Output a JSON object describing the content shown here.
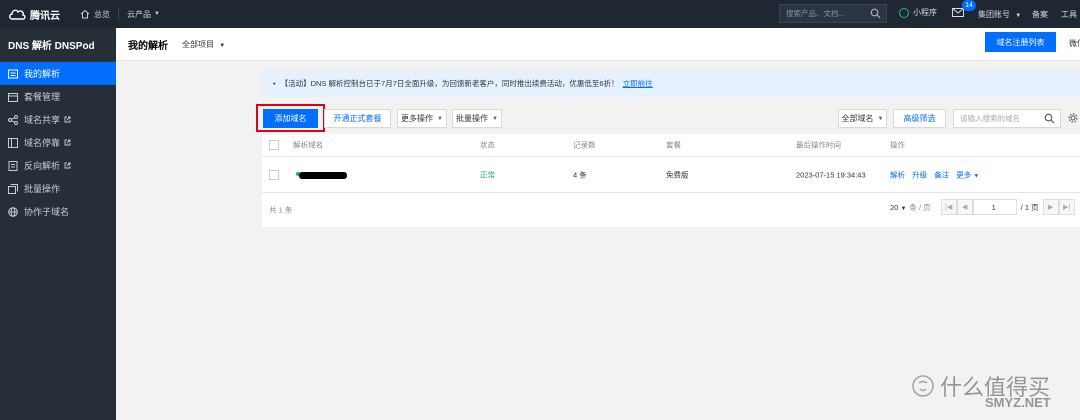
{
  "topbar": {
    "brand": "腾讯云",
    "overview": "总览",
    "products": "云产品",
    "search_placeholder": "搜索产品、文档...",
    "mini_program": "小程序",
    "mail_badge": "14",
    "account": "集团账号",
    "beian": "备案",
    "tools": "工具"
  },
  "sidebar": {
    "title": "DNS 解析 DNSPod",
    "items": [
      {
        "label": "我的解析",
        "icon": "list-icon",
        "active": true
      },
      {
        "label": "套餐管理",
        "icon": "calendar-icon"
      },
      {
        "label": "域名共享",
        "icon": "share-icon",
        "external": true
      },
      {
        "label": "域名停靠",
        "icon": "dock-icon",
        "external": true
      },
      {
        "label": "反向解析",
        "icon": "doc-icon",
        "external": true
      },
      {
        "label": "批量操作",
        "icon": "batch-icon"
      },
      {
        "label": "协作子域名",
        "icon": "globe-icon"
      }
    ]
  },
  "header": {
    "title": "我的解析",
    "project": "全部项目",
    "register_list": "域名注册列表",
    "wechat": "微信"
  },
  "notice": {
    "text": "【活动】DNS 解析控制台已于7月7日全面升级，为回馈新老客户，同时推出续费活动，优惠低至6折！",
    "link": "立即前往"
  },
  "toolbar": {
    "add_domain": "添加域名",
    "open_package": "开通正式套餐",
    "more_ops": "更多操作",
    "batch_ops": "批量操作",
    "all_domains": "全部域名",
    "advanced_filter": "高级筛选",
    "search_placeholder": "请输入搜索的域名"
  },
  "table": {
    "headers": {
      "domain": "解析域名",
      "status": "状态",
      "records": "记录数",
      "package": "套餐",
      "last_op": "最后操作时间",
      "ops": "操作"
    },
    "rows": [
      {
        "status": "正常",
        "records": "4 条",
        "package": "免费版",
        "last_op": "2023-07-15 19:34:43",
        "op_resolve": "解析",
        "op_upgrade": "升级",
        "op_note": "备注",
        "op_more": "更多"
      }
    ]
  },
  "footer": {
    "total": "共 1 条",
    "page_size": "20",
    "per_page": "条 / 页",
    "page": "1",
    "page_total": "/ 1 页"
  },
  "watermark": {
    "text": "什么值得买",
    "site": "SMYZ.NET"
  },
  "colors": {
    "primary": "#006eff",
    "topbar": "#1f2733",
    "sidebar": "#262e38",
    "ok": "#0abf5b",
    "highlight": "#e0001b"
  }
}
